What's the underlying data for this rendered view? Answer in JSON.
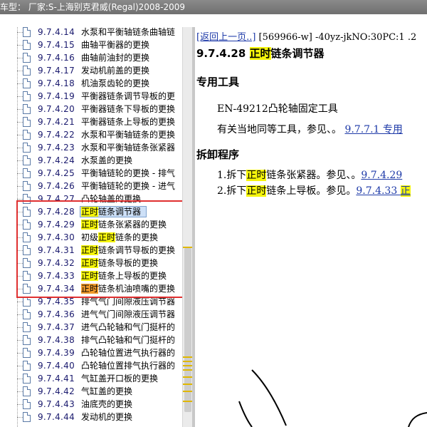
{
  "window": {
    "title": "车型： 厂家:S-上海别克君威(Regal)2008-2009"
  },
  "tree": {
    "items": [
      {
        "num": "9.7.4.14",
        "label": "水泵和平衡轴链条曲轴链"
      },
      {
        "num": "9.7.4.15",
        "label": "曲轴平衡器的更换"
      },
      {
        "num": "9.7.4.16",
        "label": "曲轴前油封的更换"
      },
      {
        "num": "9.7.4.17",
        "label": "发动机前盖的更换"
      },
      {
        "num": "9.7.4.18",
        "label": "机油泵齿轮的更换"
      },
      {
        "num": "9.7.4.19",
        "label": "平衡器链条调节导板的更"
      },
      {
        "num": "9.7.4.20",
        "label": "平衡器链条下导板的更换"
      },
      {
        "num": "9.7.4.21",
        "label": "平衡器链条上导板的更换"
      },
      {
        "num": "9.7.4.22",
        "label": "水泵和平衡轴链条的更换"
      },
      {
        "num": "9.7.4.23",
        "label": "水泵和平衡轴链条张紧器"
      },
      {
        "num": "9.7.4.24",
        "label": "水泵盖的更换"
      },
      {
        "num": "9.7.4.25",
        "label": "平衡轴链轮的更换 - 排气"
      },
      {
        "num": "9.7.4.26",
        "label": "平衡轴链轮的更换 - 进气"
      },
      {
        "num": "9.7.4.27",
        "label": "凸轮轴盖的更换"
      },
      {
        "num": "9.7.4.28",
        "pre": "",
        "hl": "正时",
        "post": "链条调节器"
      },
      {
        "num": "9.7.4.29",
        "pre": "",
        "hl": "正时",
        "post": "链条张紧器的更换"
      },
      {
        "num": "9.7.4.30",
        "pre": "初级",
        "hl": "正时",
        "post": "链条的更换"
      },
      {
        "num": "9.7.4.31",
        "pre": "",
        "hl": "正时",
        "post": "链条调节导板的更换"
      },
      {
        "num": "9.7.4.32",
        "pre": "",
        "hl": "正时",
        "post": "链条导板的更换"
      },
      {
        "num": "9.7.4.33",
        "pre": "",
        "hl": "正时",
        "post": "链条上导板的更换"
      },
      {
        "num": "9.7.4.34",
        "pre": "",
        "hl": "正时",
        "post": "链条机油喷嘴的更换"
      },
      {
        "num": "9.7.4.35",
        "label": "排气气门间隙液压调节器"
      },
      {
        "num": "9.7.4.36",
        "label": "进气气门间隙液压调节器"
      },
      {
        "num": "9.7.4.37",
        "label": "进气凸轮轴和气门挺杆的"
      },
      {
        "num": "9.7.4.38",
        "label": "排气凸轮轴和气门挺杆的"
      },
      {
        "num": "9.7.4.39",
        "label": "凸轮轴位置进气执行器的"
      },
      {
        "num": "9.7.4.40",
        "label": "凸轮轴位置排气执行器的"
      },
      {
        "num": "9.7.4.41",
        "label": "气缸盖开口板的更换"
      },
      {
        "num": "9.7.4.42",
        "label": "气缸盖的更换"
      },
      {
        "num": "9.7.4.43",
        "label": "油底壳的更换"
      },
      {
        "num": "9.7.4.44",
        "label": "发动机的更换"
      }
    ]
  },
  "content": {
    "nav_link": "[返回上一页..]",
    "nav_meta": " [569966-w] -40yz-jkNO:30PC:1 .2",
    "heading_num": "9.7.4.28 ",
    "heading_hl": "正时",
    "heading_rest": "链条调节器",
    "tools_title": "专用工具",
    "tool_1": "EN-49212凸轮轴固定工具",
    "equiv_text": "有关当地同等工具，参见、。",
    "equiv_link": "9.7.7.1 专用",
    "procedure_title": "拆卸程序",
    "step1_pre": "1.拆下",
    "step1_hl": "正时",
    "step1_post": "链条张紧器。参见、。",
    "step1_link": "9.7.4.29",
    "step2_pre": "2.拆下",
    "step2_hl": "正时",
    "step2_post": "链条上导板。参见。",
    "step2_link_a": "9.7.4.33 ",
    "step2_link_b": "正"
  },
  "colors": {
    "keyword_highlight": "#f5f50b",
    "current_highlight": "#f29b2b",
    "annotation_box": "#e03030",
    "link": "#1e3aa8"
  }
}
